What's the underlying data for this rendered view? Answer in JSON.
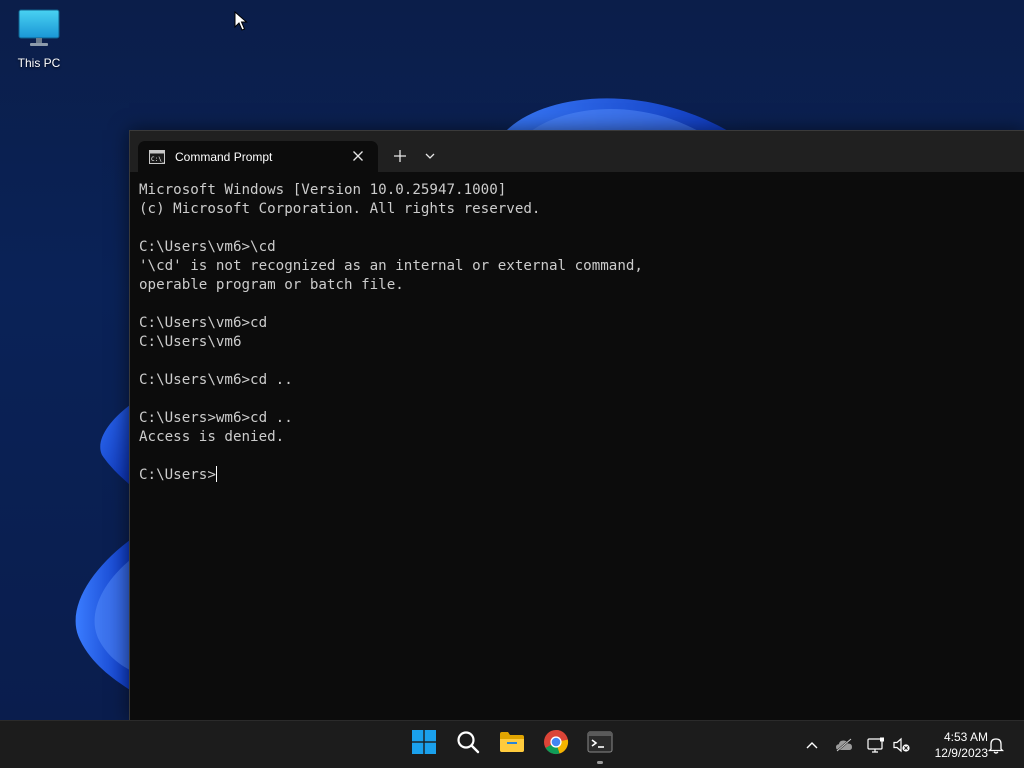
{
  "desktop": {
    "icons": [
      {
        "label": "This PC",
        "icon": "monitor-icon"
      }
    ]
  },
  "terminal": {
    "tab": {
      "title": "Command Prompt",
      "icon": "cmd-icon"
    },
    "new_tab_icon": "plus-icon",
    "dropdown_icon": "chevron-down-icon",
    "lines": [
      "Microsoft Windows [Version 10.0.25947.1000]",
      "(c) Microsoft Corporation. All rights reserved.",
      "",
      "C:\\Users\\vm6>\\cd",
      "'\\cd' is not recognized as an internal or external command,",
      "operable program or batch file.",
      "",
      "C:\\Users\\vm6>cd",
      "C:\\Users\\vm6",
      "",
      "C:\\Users\\vm6>cd ..",
      "",
      "C:\\Users>wm6>cd ..",
      "Access is denied.",
      ""
    ],
    "prompt": "C:\\Users>",
    "colors": {
      "background": "#0c0c0c",
      "text": "#cccccc",
      "tabbar": "#202020"
    }
  },
  "taskbar": {
    "pinned": [
      {
        "name": "start",
        "icon": "windows-logo-icon"
      },
      {
        "name": "search",
        "icon": "search-icon"
      },
      {
        "name": "file-explorer",
        "icon": "folder-icon"
      },
      {
        "name": "chrome",
        "icon": "chrome-icon"
      },
      {
        "name": "terminal",
        "icon": "terminal-icon",
        "running": true
      }
    ],
    "tray": {
      "icons": [
        "chevron-up-icon",
        "onedrive-icon",
        "network-icon",
        "volume-muted-icon"
      ],
      "time": "4:53 AM",
      "date": "12/9/2023",
      "notification_icon": "bell-icon"
    },
    "colors": {
      "accent": "#0078d4"
    }
  }
}
